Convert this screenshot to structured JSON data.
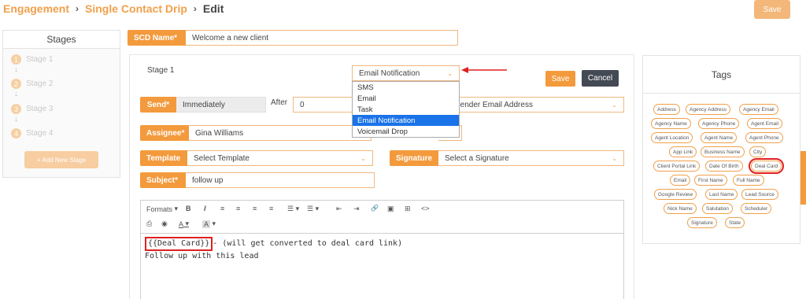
{
  "breadcrumb": {
    "item1": "Engagement",
    "item2": "Single Contact Drip",
    "item3": "Edit",
    "sep": "›"
  },
  "top_save": "Save",
  "stages": {
    "title": "Stages",
    "items": [
      {
        "num": "1",
        "label": "Stage 1"
      },
      {
        "num": "2",
        "label": "Stage 2"
      },
      {
        "num": "3",
        "label": "Stage 3"
      },
      {
        "num": "4",
        "label": "Stage 4"
      }
    ],
    "add_button": "+ Add New Stage"
  },
  "scd_name": {
    "label": "SCD Name*",
    "value": "Welcome a new client"
  },
  "stage_title": "Stage 1",
  "type_select": {
    "value": "Email Notification",
    "options": [
      "SMS",
      "Email",
      "Task",
      "Email Notification",
      "Voicemail Drop"
    ],
    "selected_index": 3
  },
  "save_label": "Save",
  "cancel_label": "Cancel",
  "send": {
    "label": "Send*",
    "value": "Immediately",
    "after_label": "After",
    "after_value": "0"
  },
  "sender": {
    "placeholder": "Sender Email Address"
  },
  "assignee": {
    "label": "Assignee*",
    "value": "Gina Williams"
  },
  "template": {
    "label": "Template",
    "value": "Select Template"
  },
  "signature": {
    "label": "Signature",
    "value": "Select a Signature"
  },
  "subject": {
    "label": "Subject*",
    "value": "follow up"
  },
  "toolbar": {
    "formats": "Formats",
    "bold": "B",
    "italic": "I",
    "align_left": "≡",
    "align_center": "≡",
    "align_right": "≡",
    "align_justify": "≡",
    "bullets": "☰",
    "numbers": "☰",
    "outdent": "⇤",
    "indent": "⇥",
    "link": "🔗",
    "image": "▣",
    "embed": "⊞",
    "code": "<>",
    "print": "⎙",
    "preview": "◉",
    "text_color": "A",
    "bg_color": "A"
  },
  "editor": {
    "deal_card": "{{Deal Card}}",
    "line1_rest": "- (will get converted to deal card link)",
    "line2": "Follow up with this lead"
  },
  "tags": {
    "title": "Tags",
    "items": [
      "Address",
      "Agency Address",
      "Agency Email",
      "Agency Name",
      "Agency Phone",
      "Agent Email",
      "Agent Location",
      "Agent Name",
      "Agent Phone",
      "App Link",
      "Business Name",
      "City",
      "Client Portal Link",
      "Date Of Birth",
      "Deal Card",
      "Email",
      "First Name",
      "Full Name",
      "Google Review",
      "Last Name",
      "Lead Source",
      "Nick Name",
      "Salutation",
      "Scheduler",
      "Signature",
      "State"
    ],
    "highlighted": "Deal Card"
  },
  "colors": {
    "accent": "#f39a3d",
    "accent_light": "#f4b77a",
    "dark": "#434a54",
    "highlight": "#e02020",
    "select_blue": "#1a73e8"
  }
}
